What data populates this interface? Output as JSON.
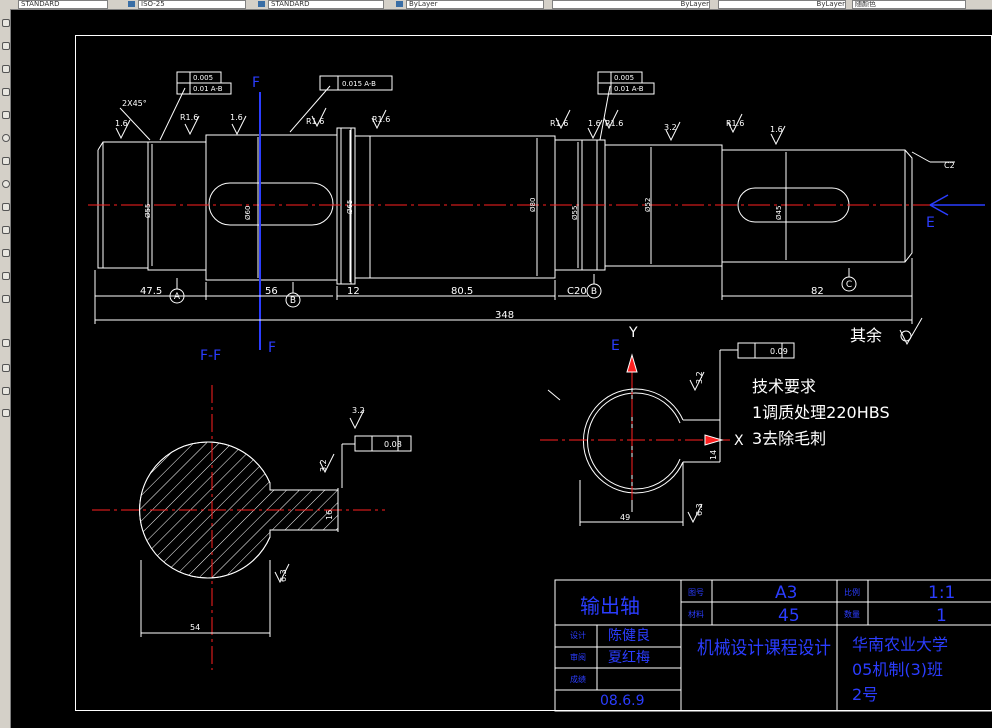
{
  "toolbar": {
    "fields": [
      "STANDARD",
      "ISO-25",
      "STANDARD",
      "ByLayer",
      "ByLayer",
      "ByLayer",
      "随颜色"
    ]
  },
  "left_toolbar": {
    "icons": [
      "line-icon",
      "polyline-icon",
      "polygon-icon",
      "rectangle-icon",
      "arc-icon",
      "circle-icon",
      "spline-icon",
      "ellipse-icon",
      "insert-block-icon",
      "point-icon",
      "hatch-icon",
      "region-icon",
      "table-icon",
      "text-icon"
    ]
  },
  "drawing": {
    "section_label_top_f": "F",
    "section_label_bottom_f": "F",
    "section_title": "F-F",
    "view_e_top": "E",
    "view_e_label": "E",
    "axis_y": "Y",
    "axis_x": "X",
    "chamfer_left": "2X45°",
    "chamfer_right": "C2",
    "rough_1_6_a": "1.6",
    "rough_r1_6_a": "R1.6",
    "rough_1_6_b": "1.6",
    "rough_r1_6_b": "R1.6",
    "rough_r1_6_c": "R1.6",
    "rough_r1_6_d": "R1.6",
    "rough_1_6_c": "1.6",
    "rough_r1_6_e": "R1.6",
    "rough_33_a": "3.2",
    "rough_r1_6_f": "R1.6",
    "rough_1_6_d": "1.6",
    "tol_1_a": "0.005",
    "tol_1_b": "0.01 A-B",
    "tol_2": "0.015 A-B",
    "tol_3_a": "0.005",
    "tol_3_b": "0.01 A-B",
    "dia_1": "Ø55",
    "dia_2": "Ø60",
    "dia_3": "Ø65",
    "dia_4": "Ø80",
    "dia_5": "Ø55",
    "dia_6": "Ø52",
    "dia_7": "Ø45",
    "dim_47_5": "47.5",
    "dim_56": "56",
    "dim_12": "12",
    "dim_80_5": "80.5",
    "dim_c20": "C20",
    "dim_82": "82",
    "dim_348": "348",
    "datum_a": "A",
    "datum_b": "B",
    "datum_b2": "B",
    "datum_c": "C",
    "rest_rough_label": "其余",
    "tech_title": "技术要求",
    "tech_1": "1调质处理220HBS",
    "tech_3": "3去除毛刺",
    "key_tol_1": "0.08",
    "key_tol_2": "0.09",
    "rough_32_a": "3.2",
    "rough_32_b": "3.2",
    "rough_32_c": "3.2",
    "rough_63_a": "6.3",
    "rough_63_b": "6.3",
    "dim_16": "16",
    "dim_54": "54",
    "dim_14": "14",
    "dim_49": "49"
  },
  "title_block": {
    "part_name": "输出轴",
    "drawing_no_label": "图号",
    "drawing_no": "A3",
    "material_label": "材料",
    "material": "45",
    "scale_label": "比例",
    "scale": "1:1",
    "qty_label": "数量",
    "qty": "1",
    "designer_label": "设计",
    "designer": "陈健良",
    "reviewer_label": "审阅",
    "reviewer": "夏红梅",
    "grade_label": "成绩",
    "date": "08.6.9",
    "course": "机械设计课程设计",
    "school_1": "华南农业大学",
    "school_2": "05机制(3)班",
    "school_3": "2号"
  }
}
